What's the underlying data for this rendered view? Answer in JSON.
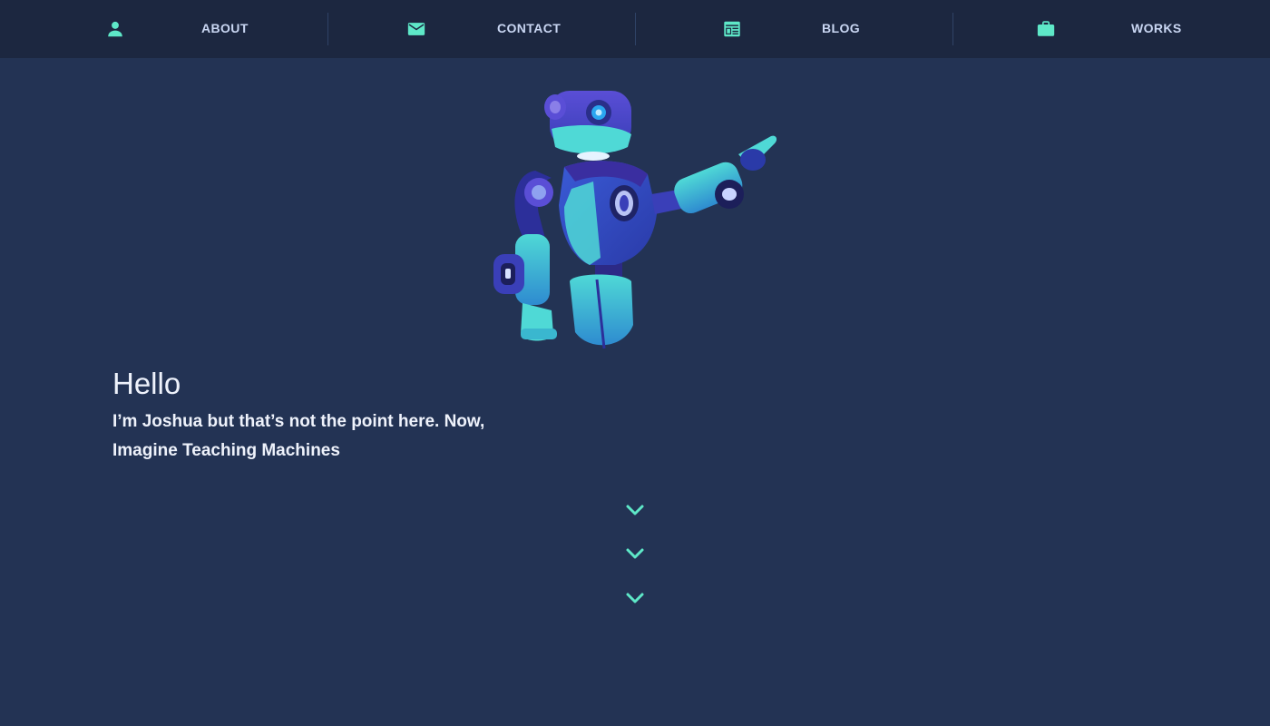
{
  "nav": {
    "items": [
      {
        "label": "ABOUT",
        "icon": "person-icon"
      },
      {
        "label": "CONTACT",
        "icon": "mail-icon"
      },
      {
        "label": "BLOG",
        "icon": "newspaper-icon"
      },
      {
        "label": "WORKS",
        "icon": "briefcase-icon"
      }
    ]
  },
  "hero": {
    "greeting": "Hello",
    "line1": "I’m Joshua but that’s not the point here. Now,",
    "line2": "Imagine Teaching Machines",
    "illustration": "robot-illustration"
  },
  "scroll_indicator": {
    "icon": "chevron-down-icon",
    "count": 3
  },
  "colors": {
    "background": "#233354",
    "nav_background": "#1c2740",
    "accent": "#5ee8c8",
    "nav_text": "#c9d6f2",
    "text": "#eef2fb"
  }
}
